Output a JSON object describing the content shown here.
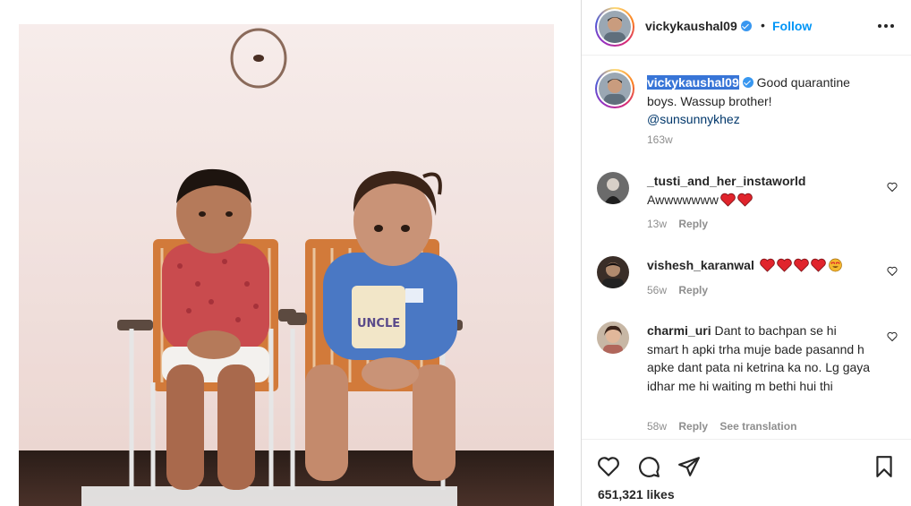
{
  "post": {
    "author": "vickykaushal09",
    "separator": "•",
    "follow_label": "Follow",
    "caption_text": "Good quarantine boys. Wassup brother!",
    "caption_mention": "@sunsunnykhez",
    "caption_time": "163w",
    "likes": "651,321 likes"
  },
  "comments": [
    {
      "user": "_tusti_and_her_instaworld",
      "text": "Awwwwwww",
      "emojis": [
        "red-heart",
        "red-heart"
      ],
      "time": "13w",
      "reply_label": "Reply"
    },
    {
      "user": "vishesh_karanwal",
      "text": "",
      "emojis": [
        "red-heart",
        "red-heart",
        "red-heart",
        "red-heart",
        "heart-eyes"
      ],
      "time": "56w",
      "reply_label": "Reply"
    },
    {
      "user": "charmi_uri",
      "text": "Dant to bachpan se hi smart h apki trha muje bade pasannd h apke dant pata ni ketrina ka no. Lg gaya idhar me hi waiting m bethi hui thi",
      "emojis": [],
      "time": "58w",
      "reply_label": "Reply",
      "translate_label": "See translation"
    }
  ],
  "colors": {
    "accent": "#0095f6",
    "verified": "#3897f0",
    "secondary_text": "#8e8e8e",
    "heart": "#ed4956"
  },
  "icons": [
    "more-icon",
    "verified-icon",
    "heart-icon",
    "comment-icon",
    "share-icon",
    "bookmark-icon"
  ]
}
